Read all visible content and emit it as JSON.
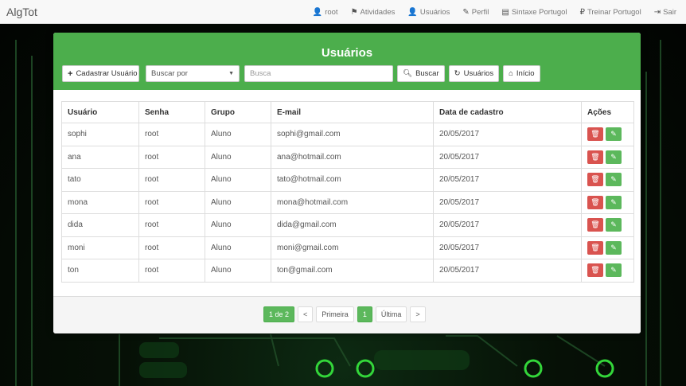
{
  "app": {
    "brand": "AlgTot"
  },
  "nav": [
    {
      "icon": "user-icon",
      "glyph": "👤",
      "label": "root"
    },
    {
      "icon": "activities-icon",
      "glyph": "⚑",
      "label": "Atividades"
    },
    {
      "icon": "users-icon",
      "glyph": "👤",
      "label": "Usuários"
    },
    {
      "icon": "edit-icon",
      "glyph": "✎",
      "label": "Perfil"
    },
    {
      "icon": "book-icon",
      "glyph": "▤",
      "label": "Sintaxe Portugol"
    },
    {
      "icon": "train-icon",
      "glyph": "₽",
      "label": "Treinar Portugol"
    },
    {
      "icon": "logout-icon",
      "glyph": "⇥",
      "label": "Sair"
    }
  ],
  "panel": {
    "title": "Usuários",
    "add_button": "Cadastrar Usuário",
    "search_by": "Buscar por",
    "search_placeholder": "Busca",
    "search_button": "Buscar",
    "users_button": "Usuários",
    "home_button": "Início"
  },
  "table": {
    "headers": [
      "Usuário",
      "Senha",
      "Grupo",
      "E-mail",
      "Data de cadastro",
      "Ações"
    ],
    "rows": [
      [
        "sophi",
        "root",
        "Aluno",
        "sophi@gmail.com",
        "20/05/2017"
      ],
      [
        "ana",
        "root",
        "Aluno",
        "ana@hotmail.com",
        "20/05/2017"
      ],
      [
        "tato",
        "root",
        "Aluno",
        "tato@hotmail.com",
        "20/05/2017"
      ],
      [
        "mona",
        "root",
        "Aluno",
        "mona@hotmail.com",
        "20/05/2017"
      ],
      [
        "dida",
        "root",
        "Aluno",
        "dida@gmail.com",
        "20/05/2017"
      ],
      [
        "moni",
        "root",
        "Aluno",
        "moni@gmail.com",
        "20/05/2017"
      ],
      [
        "ton",
        "root",
        "Aluno",
        "ton@gmail.com",
        "20/05/2017"
      ]
    ]
  },
  "pagination": {
    "info": "1 de 2",
    "prev": "<",
    "first": "Primeira",
    "current": "1",
    "last": "Última",
    "next": ">"
  },
  "colors": {
    "accent": "#4cae4c",
    "danger": "#d9534f",
    "success": "#5cb85c"
  }
}
